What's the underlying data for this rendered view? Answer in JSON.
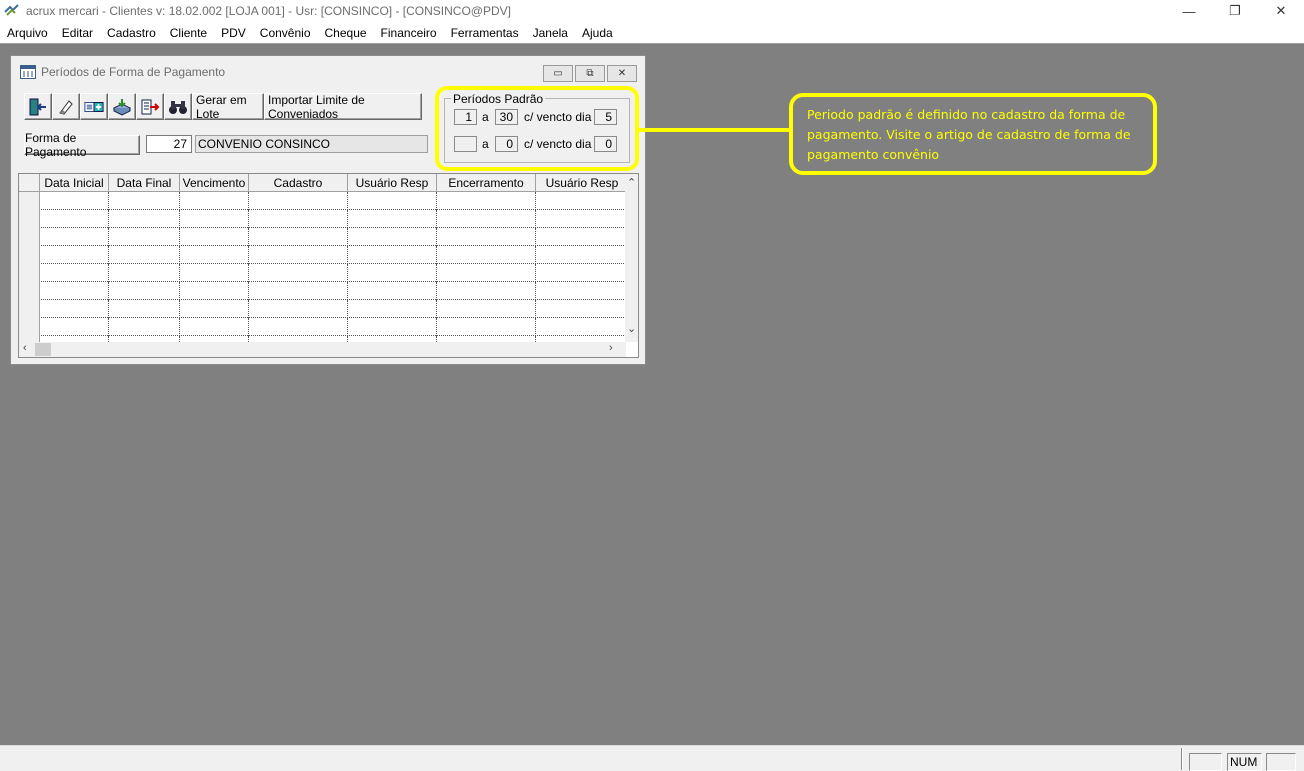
{
  "app": {
    "title": "acrux mercari - Clientes  v: 18.02.002  [LOJA 001] - Usr: [CONSINCO] - [CONSINCO@PDV]",
    "controls": {
      "minimize": "—",
      "restore": "❐",
      "close": "✕"
    }
  },
  "menu": {
    "items": [
      "Arquivo",
      "Editar",
      "Cadastro",
      "Cliente",
      "PDV",
      "Convênio",
      "Cheque",
      "Financeiro",
      "Ferramentas",
      "Janela",
      "Ajuda"
    ]
  },
  "child_window": {
    "title": "Períodos de Forma de Pagamento",
    "controls": {
      "minimize": "▭",
      "restore": "⧉",
      "close": "✕"
    }
  },
  "toolbar": {
    "icons": [
      "exit-icon",
      "eraser-icon",
      "add-record-icon",
      "save-icon",
      "export-icon",
      "binoculars-icon"
    ],
    "gerar_em_lote": "Gerar em Lote",
    "importar_limite": "Importar Limite de Conveniados"
  },
  "forma_pagamento": {
    "button_label": "Forma de Pagamento",
    "code": "27",
    "name": "CONVENIO CONSINCO"
  },
  "periodos_padrao": {
    "legend": "Períodos Padrão",
    "row1": {
      "from": "1",
      "a_label": "a",
      "to": "30",
      "vencto_label": "c/ vencto dia",
      "day": "5"
    },
    "row2": {
      "from": "",
      "a_label": "a",
      "to": "0",
      "vencto_label": "c/ vencto dia",
      "day": "0"
    }
  },
  "grid": {
    "columns": [
      "Data Inicial",
      "Data Final",
      "Vencimento",
      "Cadastro",
      "Usuário Resp",
      "Encerramento",
      "Usuário Resp"
    ],
    "rows": []
  },
  "callout": {
    "text": "Periodo padrão é definido no cadastro da forma de pagamento. Visite o artigo de cadastro de forma de pagamento convênio",
    "color": "#ffff00"
  },
  "statusbar": {
    "num": "NUM"
  }
}
